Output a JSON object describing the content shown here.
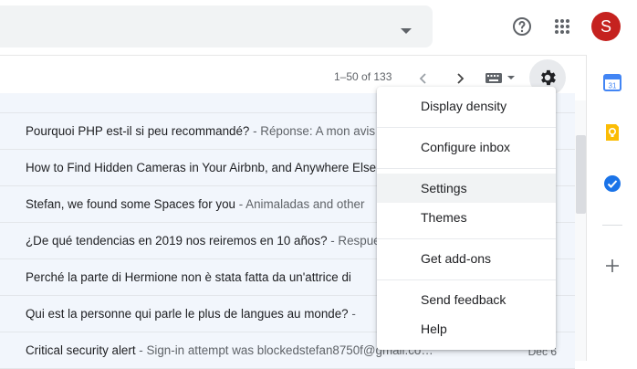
{
  "header": {
    "avatar_initial": "S",
    "avatar_color": "#c5221f"
  },
  "toolbar": {
    "pagination": "1–50 of 133"
  },
  "emails": [
    {
      "subject": "Pourquoi PHP est-il si peu recommandé?",
      "snippet": " - Réponse: A mon avis",
      "date": ""
    },
    {
      "subject": "How to Find Hidden Cameras in Your Airbnb, and Anywhere Else",
      "snippet": "",
      "date": ""
    },
    {
      "subject": "Stefan, we found some Spaces for you",
      "snippet": " - Animaladas and other",
      "date": ""
    },
    {
      "subject": "¿De qué tendencias en 2019 nos reiremos en 10 años?",
      "snippet": " - Respuesta",
      "date": ""
    },
    {
      "subject": "Perché la parte di Hermione non è stata fatta da un'attrice di",
      "snippet": "",
      "date": ""
    },
    {
      "subject": "Qui est la personne qui parle le plus de langues au monde?",
      "snippet": " - ",
      "date": ""
    },
    {
      "subject": "Critical security alert",
      "snippet": " - Sign-in attempt was blockedstefan8750f@gmail.co…",
      "date": "Dec 6"
    }
  ],
  "settings_menu": {
    "items": [
      "Display density",
      "Configure inbox",
      "Settings",
      "Themes",
      "Get add-ons",
      "Send feedback",
      "Help"
    ]
  },
  "side_panel": {
    "calendar_day": "31"
  },
  "colors": {
    "accent_blue": "#1a73e8",
    "keep_yellow": "#fbbc04",
    "row_bg": "#f2f6fc"
  }
}
